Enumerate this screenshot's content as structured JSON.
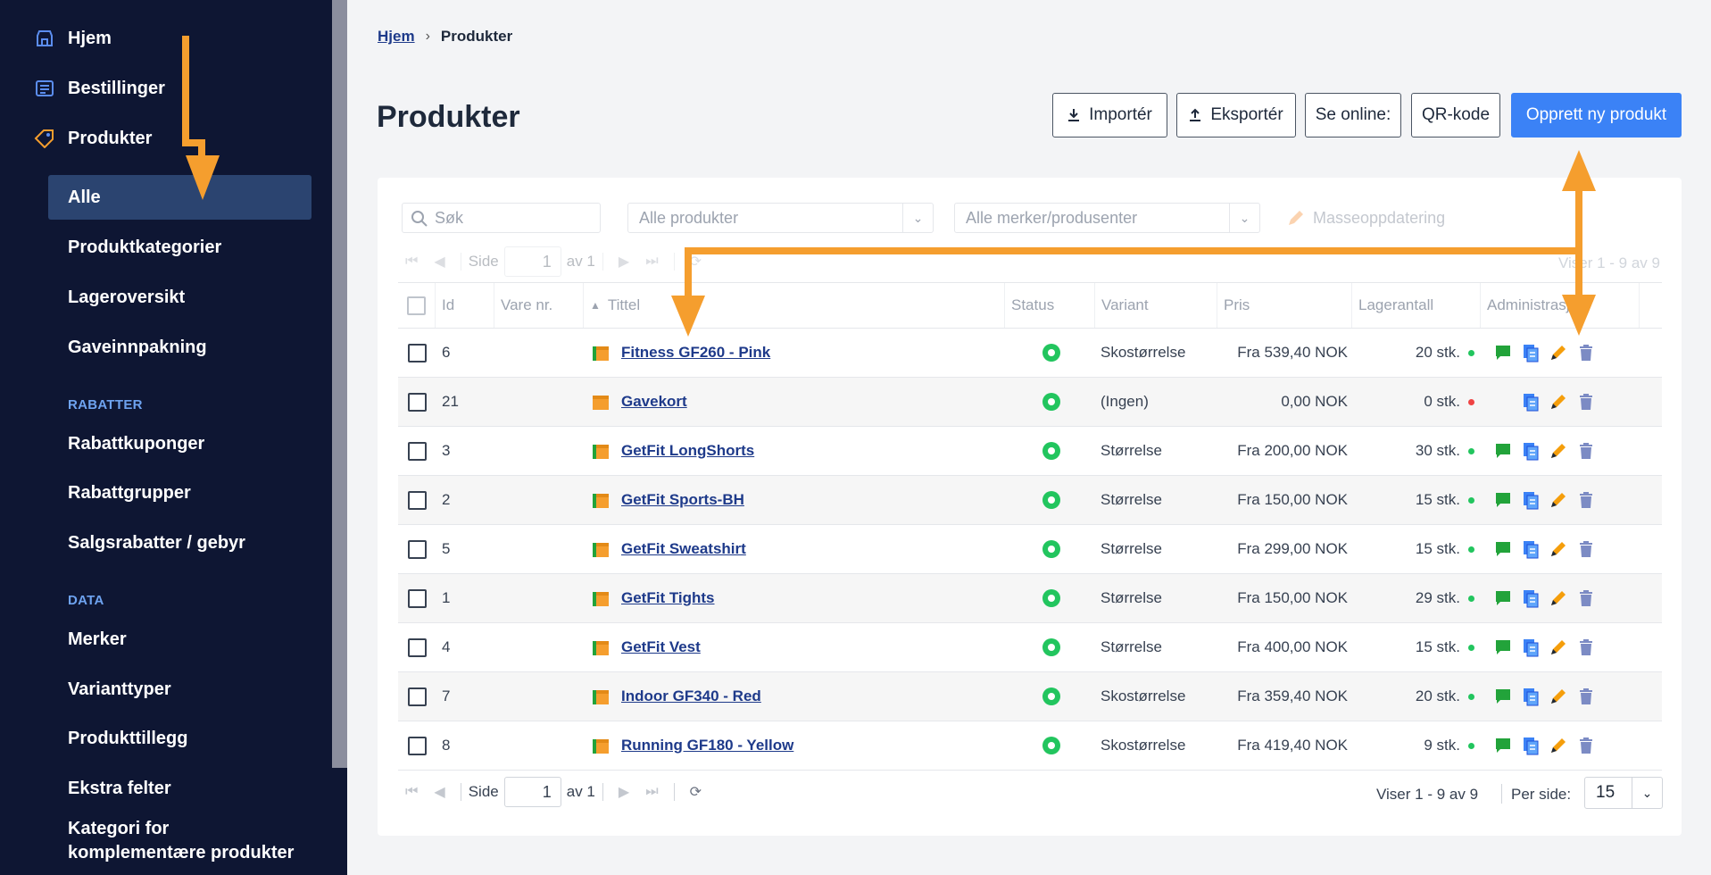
{
  "sidebar": {
    "top_items": [
      {
        "label": "Hjem",
        "icon": "store-icon"
      },
      {
        "label": "Bestillinger",
        "icon": "list-icon"
      },
      {
        "label": "Produkter",
        "icon": "tag-icon"
      }
    ],
    "products_sub": [
      "Alle",
      "Produktkategorier",
      "Lageroversikt",
      "Gaveinnpakning"
    ],
    "section_rabatter": "RABATTER",
    "rabatter_items": [
      "Rabattkuponger",
      "Rabattgrupper",
      "Salgsrabatter / gebyr"
    ],
    "section_data": "DATA",
    "data_items": [
      "Merker",
      "Varianttyper",
      "Produkttillegg",
      "Ekstra felter"
    ],
    "last_item_line1": "Kategori for",
    "last_item_line2": "komplementære produkter"
  },
  "breadcrumb": {
    "home": "Hjem",
    "separator": "›",
    "current": "Produkter"
  },
  "page_title": "Produkter",
  "buttons": {
    "import": "Importér",
    "export": "Eksportér",
    "see_online": "Se online:",
    "qr": "QR-kode",
    "create": "Opprett ny produkt"
  },
  "toolbar": {
    "search_placeholder": "Søk",
    "filter_products": "Alle produkter",
    "filter_brands": "Alle merker/produsenter",
    "mass_update": "Masseoppdatering"
  },
  "pager": {
    "page_label": "Side",
    "page_value": "1",
    "of_label": "av 1",
    "showing": "Viser 1 - 9 av 9",
    "per_page_label": "Per side:",
    "per_page_value": "15"
  },
  "columns": [
    "Id",
    "Vare nr.",
    "Tittel",
    "Status",
    "Variant",
    "Pris",
    "Lagerantall",
    "Administrasjon"
  ],
  "rows": [
    {
      "id": "6",
      "sku": "",
      "title": "Fitness GF260 - Pink",
      "variant": "Skostørrelse",
      "price": "Fra 539,40 NOK",
      "stock": "20 stk.",
      "in_stock": true,
      "has_comment": true
    },
    {
      "id": "21",
      "sku": "",
      "title": "Gavekort",
      "variant": "(Ingen)",
      "price": "0,00 NOK",
      "stock": "0 stk.",
      "in_stock": false,
      "has_comment": false
    },
    {
      "id": "3",
      "sku": "",
      "title": "GetFit LongShorts",
      "variant": "Størrelse",
      "price": "Fra 200,00 NOK",
      "stock": "30 stk.",
      "in_stock": true,
      "has_comment": true
    },
    {
      "id": "2",
      "sku": "",
      "title": "GetFit Sports-BH",
      "variant": "Størrelse",
      "price": "Fra 150,00 NOK",
      "stock": "15 stk.",
      "in_stock": true,
      "has_comment": true
    },
    {
      "id": "5",
      "sku": "",
      "title": "GetFit Sweatshirt",
      "variant": "Størrelse",
      "price": "Fra 299,00 NOK",
      "stock": "15 stk.",
      "in_stock": true,
      "has_comment": true
    },
    {
      "id": "1",
      "sku": "",
      "title": "GetFit Tights",
      "variant": "Størrelse",
      "price": "Fra 150,00 NOK",
      "stock": "29 stk.",
      "in_stock": true,
      "has_comment": true
    },
    {
      "id": "4",
      "sku": "",
      "title": "GetFit Vest",
      "variant": "Størrelse",
      "price": "Fra 400,00 NOK",
      "stock": "15 stk.",
      "in_stock": true,
      "has_comment": true
    },
    {
      "id": "7",
      "sku": "",
      "title": "Indoor GF340 - Red",
      "variant": "Skostørrelse",
      "price": "Fra 359,40 NOK",
      "stock": "20 stk.",
      "in_stock": true,
      "has_comment": true
    },
    {
      "id": "8",
      "sku": "",
      "title": "Running GF180 - Yellow",
      "variant": "Skostørrelse",
      "price": "Fra 419,40 NOK",
      "stock": "9 stk.",
      "in_stock": true,
      "has_comment": true
    }
  ],
  "colors": {
    "sidebar_bg": "#0e1633",
    "active_item": "#2b4470",
    "primary": "#3b82f6",
    "link": "#1e3a8a",
    "annotation_arrow": "#f59e2e",
    "status_ok": "#22c55e",
    "stock_ok": "#22c55e",
    "stock_out": "#ef4444"
  }
}
